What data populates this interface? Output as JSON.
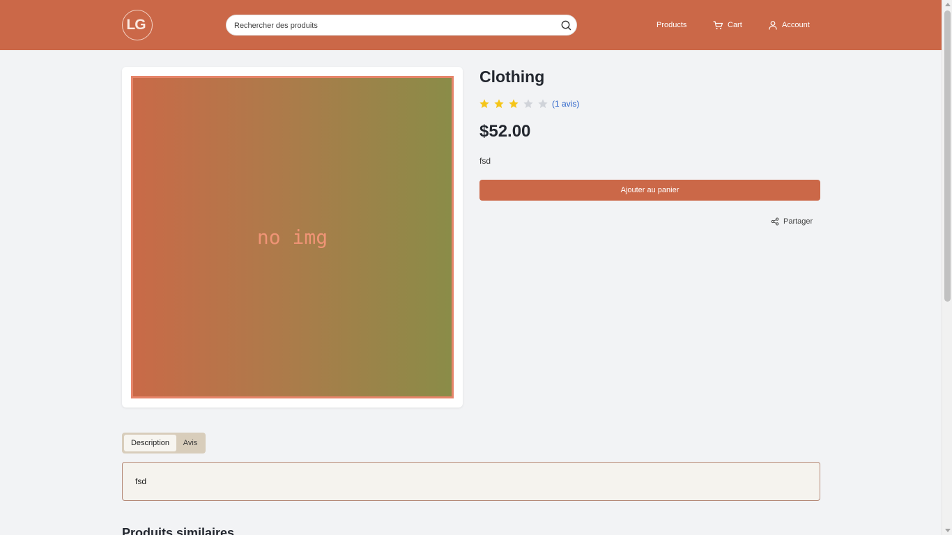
{
  "header": {
    "logo_text": "LG",
    "search_placeholder": "Rechercher des produits",
    "nav": {
      "products": "Products",
      "cart": "Cart",
      "account": "Account"
    }
  },
  "product": {
    "image_text": "no img",
    "title": "Clothing",
    "rating": 3,
    "rating_max": 5,
    "reviews_link": "(1 avis)",
    "price": "$52.00",
    "short_description": "fsd",
    "add_to_cart": "Ajouter au panier",
    "share": "Partager"
  },
  "tabs": {
    "description": "Description",
    "reviews": "Avis"
  },
  "description_panel": {
    "text": "fsd"
  },
  "similar_heading": "Produits similaires",
  "colors": {
    "brand": "#cb6848",
    "star_filled": "#f5c518",
    "star_empty": "#d0d3d9",
    "link": "#2a62c9"
  }
}
